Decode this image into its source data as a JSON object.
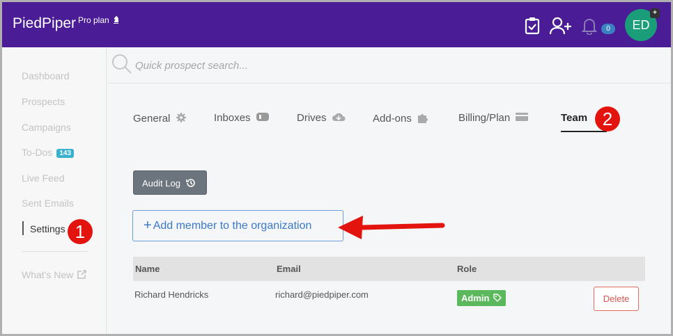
{
  "header": {
    "brand": "PiedPiper",
    "plan": "Pro plan",
    "notifications_count": "0",
    "avatar_initials": "ED",
    "avatar_plus": "+"
  },
  "search": {
    "placeholder": "Quick prospect search..."
  },
  "sidebar": {
    "items": [
      {
        "label": "Dashboard"
      },
      {
        "label": "Prospects"
      },
      {
        "label": "Campaigns"
      },
      {
        "label": "To-Dos",
        "badge": "143"
      },
      {
        "label": "Live Feed"
      },
      {
        "label": "Sent Emails"
      },
      {
        "label": "Settings"
      },
      {
        "label": "What's New"
      }
    ]
  },
  "tabs": [
    {
      "label": "General",
      "icon": "gear-icon"
    },
    {
      "label": "Inboxes",
      "icon": "mailbox-icon"
    },
    {
      "label": "Drives",
      "icon": "cloud-download-icon"
    },
    {
      "label": "Add-ons",
      "icon": "puzzle-icon"
    },
    {
      "label": "Billing/Plan",
      "icon": "credit-card-icon"
    },
    {
      "label": "Team",
      "icon": ""
    }
  ],
  "buttons": {
    "audit_log": "Audit Log",
    "add_member": "Add member to the organization"
  },
  "table": {
    "headers": [
      "Name",
      "Email",
      "Role"
    ],
    "rows": [
      {
        "name": "Richard Hendricks",
        "email": "richard@piedpiper.com",
        "role": "Admin",
        "action": "Delete"
      }
    ]
  },
  "annotations": {
    "callout_1": "1",
    "callout_2": "2",
    "arrow_color": "#e3140d"
  },
  "colors": {
    "topbar": "#4a1d96",
    "avatar": "#1a9e79",
    "badge": "#38b1d0",
    "admin": "#5cb85c",
    "delete": "#d9534f",
    "link": "#3a78c9"
  }
}
